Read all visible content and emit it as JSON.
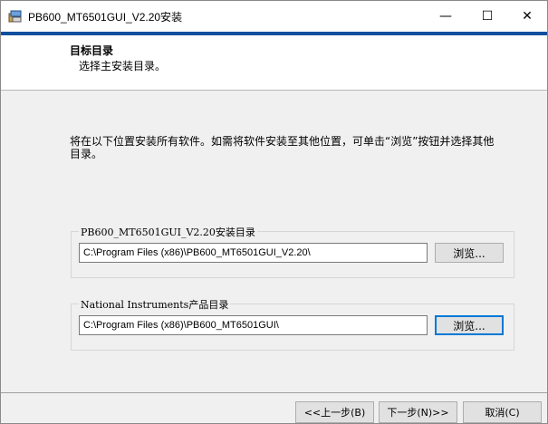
{
  "window": {
    "title": "PB600_MT6501GUI_V2.20安装",
    "icon": "installer-icon",
    "controls": {
      "minimize": "—",
      "maximize": "☐",
      "close": "✕"
    }
  },
  "header": {
    "title": "目标目录",
    "subtitle": "选择主安装目录。"
  },
  "description": "将在以下位置安装所有软件。如需将软件安装至其他位置，可单击“浏览”按钮并选择其他目录。",
  "groups": [
    {
      "legend": "PB600_MT6501GUI_V2.20安装目录",
      "path": "C:\\Program Files (x86)\\PB600_MT6501GUI_V2.20\\",
      "browse_label": "浏览..."
    },
    {
      "legend": "National Instruments产品目录",
      "path": "C:\\Program Files (x86)\\PB600_MT6501GUI\\",
      "browse_label": "浏览..."
    }
  ],
  "footer": {
    "back_label": "<<上一步(B)",
    "next_label": "下一步(N)>>",
    "cancel_label": "取消(C)"
  }
}
